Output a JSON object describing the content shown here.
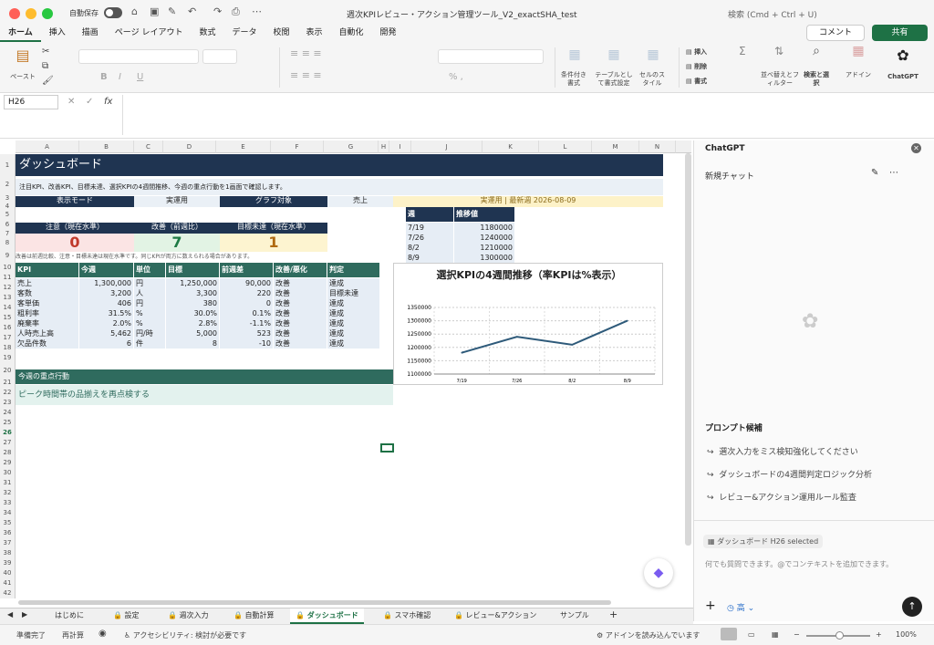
{
  "titlebar": {
    "autosave_label": "自動保存",
    "doc_title": "週次KPIレビュー・アクション管理ツール_V2_exactSHA_test",
    "search_placeholder": "検索 (Cmd + Ctrl + U)"
  },
  "ribbon_tabs": [
    "ホーム",
    "挿入",
    "描画",
    "ページ レイアウト",
    "数式",
    "データ",
    "校閲",
    "表示",
    "自動化",
    "開発"
  ],
  "buttons": {
    "comment": "コメント",
    "share": "共有"
  },
  "ribbon": {
    "paste": "ペースト",
    "cond_format": "条件付き書式",
    "table_format": "テーブルとして書式設定",
    "cell_style": "セルのスタイル",
    "insert": "挿入",
    "delete": "削除",
    "format": "書式",
    "sort_filter": "並べ替えとフィルター",
    "find_select": "検索と選択",
    "addin": "アドイン",
    "chatgpt": "ChatGPT",
    "fx": "fx"
  },
  "namebox": "H26",
  "columns": [
    "A",
    "B",
    "C",
    "D",
    "E",
    "F",
    "G",
    "H",
    "I",
    "J",
    "K",
    "L",
    "M",
    "N",
    "O"
  ],
  "rows": [
    "1",
    "2",
    "3",
    "4",
    "5",
    "6",
    "7",
    "8",
    "9",
    "10",
    "11",
    "12",
    "13",
    "14",
    "15",
    "16",
    "17",
    "18",
    "19",
    "20",
    "21",
    "22",
    "23",
    "24",
    "25",
    "26",
    "27",
    "28",
    "29",
    "30",
    "31",
    "32",
    "33",
    "34",
    "35",
    "36",
    "37",
    "38",
    "39",
    "40",
    "41",
    "42"
  ],
  "sheet": {
    "title": "ダッシュボード",
    "subtitle": "注目KPI、改善KPI、目標未達、選択KPIの4週間推移、今週の重点行動を1画面で確認します。",
    "mode_label": "表示モード",
    "mode_value": "実運用",
    "graph_label": "グラフ対象",
    "graph_value": "売上",
    "latest_week": "実運用 | 最新週 2026-08-09",
    "card_attention_label": "注意（現在水準）",
    "card_attention_value": "0",
    "card_improve_label": "改善（前週比）",
    "card_improve_value": "7",
    "card_unmet_label": "目標未達（現在水準）",
    "card_unmet_value": "1",
    "note": "改善は前週比較、注意・目標未達は現在水準です。同じKPIが両方に数えられる場合があります。",
    "kpi_headers": [
      "KPI",
      "今週",
      "単位",
      "目標",
      "前週差",
      "改善/悪化",
      "判定"
    ],
    "kpi_rows": [
      [
        "売上",
        "1,300,000",
        "円",
        "1,250,000",
        "90,000",
        "改善",
        "達成"
      ],
      [
        "客数",
        "3,200",
        "人",
        "3,300",
        "220",
        "改善",
        "目標未達"
      ],
      [
        "客単価",
        "406",
        "円",
        "380",
        "0",
        "改善",
        "達成"
      ],
      [
        "粗利率",
        "31.5%",
        "%",
        "30.0%",
        "0.1%",
        "改善",
        "達成"
      ],
      [
        "廃棄率",
        "2.0%",
        "%",
        "2.8%",
        "-1.1%",
        "改善",
        "達成"
      ],
      [
        "人時売上高",
        "5,462",
        "円/時",
        "5,000",
        "523",
        "改善",
        "達成"
      ],
      [
        "欠品件数",
        "6",
        "件",
        "8",
        "-10",
        "改善",
        "達成"
      ]
    ],
    "focus_header": "今週の重点行動",
    "focus_text": "ピーク時間帯の品揃えを再点検する",
    "trend_headers": [
      "週",
      "推移値"
    ],
    "trend_rows": [
      [
        "7/19",
        "1180000"
      ],
      [
        "7/26",
        "1240000"
      ],
      [
        "8/2",
        "1210000"
      ],
      [
        "8/9",
        "1300000"
      ]
    ]
  },
  "chart_data": {
    "type": "line",
    "title": "選択KPIの4週間推移（率KPIは%表示）",
    "categories": [
      "7/19",
      "7/26",
      "8/2",
      "8/9"
    ],
    "values": [
      1180000,
      1240000,
      1210000,
      1300000
    ],
    "ylim": [
      1100000,
      1350000
    ],
    "yticks": [
      "1350000",
      "1300000",
      "1250000",
      "1200000",
      "1150000",
      "1100000"
    ],
    "color": "#2e5a7a",
    "grid": true
  },
  "panel": {
    "title": "ChatGPT",
    "new_chat": "新規チャット",
    "prompt_header": "プロンプト候補",
    "prompts": [
      "選次入力をミス検知強化してください",
      "ダッシュボードの4週間判定ロジック分析",
      "レビュー&アクション運用ルール監査"
    ],
    "context_chip": "ダッシュボード H26 selected",
    "input_placeholder": "何でも質問できます。@でコンテキストを追加できます。",
    "mode": "高"
  },
  "sheet_tabs": [
    "はじめに",
    "設定",
    "週次入力",
    "自動計算",
    "ダッシュボード",
    "スマホ確認",
    "レビュー&アクション",
    "サンプル"
  ],
  "status": {
    "ready": "準備完了",
    "recalc": "再計算",
    "accessibility": "アクセシビリティ: 検討が必要です",
    "addin_loading": "アドインを読み込んでいます",
    "zoom": "100%"
  }
}
